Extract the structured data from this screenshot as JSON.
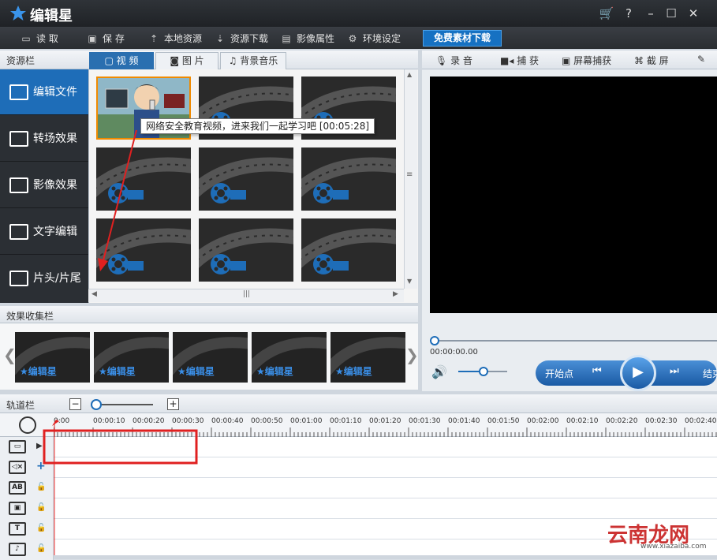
{
  "app": {
    "title": "编辑星"
  },
  "window_buttons": [
    "cart-icon",
    "help-icon",
    "minimize-icon",
    "maximize-icon",
    "close-icon"
  ],
  "toolbar": {
    "items": [
      {
        "icon": "folder-open-icon",
        "label": "读 取"
      },
      {
        "icon": "save-icon",
        "label": "保 存"
      },
      {
        "icon": "upload-icon",
        "label": "本地资源"
      },
      {
        "icon": "download-icon",
        "label": "资源下载"
      },
      {
        "icon": "video-properties-icon",
        "label": "影像属性"
      },
      {
        "icon": "gear-icon",
        "label": "环境设定"
      }
    ],
    "free_download": "免费素材下载"
  },
  "resources": {
    "title": "资源栏",
    "tabs": [
      {
        "icon": "video-icon",
        "label": "视 频",
        "active": true
      },
      {
        "icon": "camera-icon",
        "label": "图 片",
        "active": false
      },
      {
        "icon": "music-icon",
        "label": "背景音乐",
        "active": false
      }
    ],
    "sidebar": [
      {
        "label": "编辑文件",
        "icon": "film-strip-icon",
        "active": true
      },
      {
        "label": "转场效果",
        "icon": "ab-transition-icon",
        "active": false
      },
      {
        "label": "影像效果",
        "icon": "image-effect-icon",
        "active": false
      },
      {
        "label": "文字编辑",
        "icon": "text-icon",
        "active": false
      },
      {
        "label": "片头/片尾",
        "icon": "intro-outro-icon",
        "active": false
      }
    ],
    "tooltip": "网络安全教育视频，进来我们一起学习吧 [00:05:28]"
  },
  "effects": {
    "title": "效果收集栏",
    "thumb_label": "编辑星",
    "count": 5
  },
  "preview": {
    "tools": [
      {
        "icon": "microphone-icon",
        "label": "录 音"
      },
      {
        "icon": "camcorder-icon",
        "label": "捕 获"
      },
      {
        "icon": "monitor-icon",
        "label": "屏幕捕获"
      },
      {
        "icon": "screenshot-icon",
        "label": "截 屏"
      },
      {
        "icon": "brush-icon",
        "label": ""
      }
    ],
    "timecode": "00:00:00.00",
    "start_point": "开始点",
    "end_point": "结束点"
  },
  "track": {
    "title": "轨道栏",
    "ruler": [
      "0:00",
      "00:00:10",
      "00:00:20",
      "00:00:30",
      "00:00:40",
      "00:00:50",
      "00:01:00",
      "00:01:10",
      "00:01:20",
      "00:01:30",
      "00:01:40",
      "00:01:50",
      "00:02:00",
      "00:02:10",
      "00:02:20",
      "00:02:30",
      "00:02:40"
    ],
    "rows": [
      {
        "icon": "video-track-icon",
        "glyph": "▭"
      },
      {
        "icon": "audio-mute-icon",
        "glyph": "◁×"
      },
      {
        "icon": "ab-transition-track-icon",
        "glyph": "AB"
      },
      {
        "icon": "effect-track-icon",
        "glyph": "▣"
      },
      {
        "icon": "text-track-icon",
        "glyph": "T"
      },
      {
        "icon": "music-track-icon",
        "glyph": "♪"
      }
    ]
  },
  "colors": {
    "accent": "#1e6db8",
    "annotation": "#e02020"
  },
  "watermark": {
    "text": "云南龙网",
    "sub": "www.xiazaiba.com"
  }
}
